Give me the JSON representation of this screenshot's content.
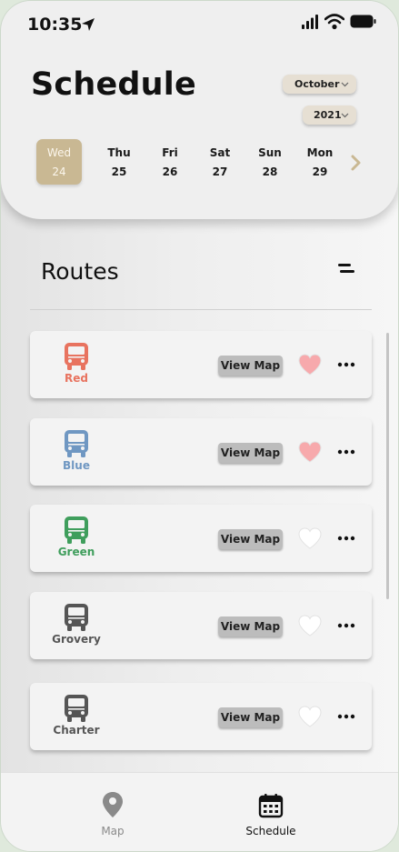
{
  "status_bar": {
    "time": "10:35"
  },
  "header": {
    "title": "Schedule",
    "month": "October",
    "year": "2021",
    "days": [
      {
        "name": "Wed",
        "date": "24",
        "selected": true
      },
      {
        "name": "Thu",
        "date": "25"
      },
      {
        "name": "Fri",
        "date": "26"
      },
      {
        "name": "Sat",
        "date": "27"
      },
      {
        "name": "Sun",
        "date": "28"
      },
      {
        "name": "Mon",
        "date": "29"
      }
    ]
  },
  "routes_section": {
    "title": "Routes",
    "view_map_label": "View Map",
    "routes": [
      {
        "name": "Red",
        "color": "#e8735f",
        "favorited": true
      },
      {
        "name": "Blue",
        "color": "#6f97c2",
        "favorited": true
      },
      {
        "name": "Green",
        "color": "#3f9e5c",
        "favorited": false
      },
      {
        "name": "Grovery",
        "color": "#555555",
        "favorited": false
      },
      {
        "name": "Charter",
        "color": "#555555",
        "favorited": false
      }
    ]
  },
  "bottom_nav": {
    "tabs": [
      {
        "label": "Map",
        "icon": "map-pin-icon",
        "active": false
      },
      {
        "label": "Schedule",
        "icon": "calendar-icon",
        "active": true
      }
    ]
  },
  "colors": {
    "selected_day": "#c9b893",
    "heart_favorited": "#f7a9ac",
    "heart_default": "#ffffff",
    "pill_bg": "#e6dfd3"
  }
}
